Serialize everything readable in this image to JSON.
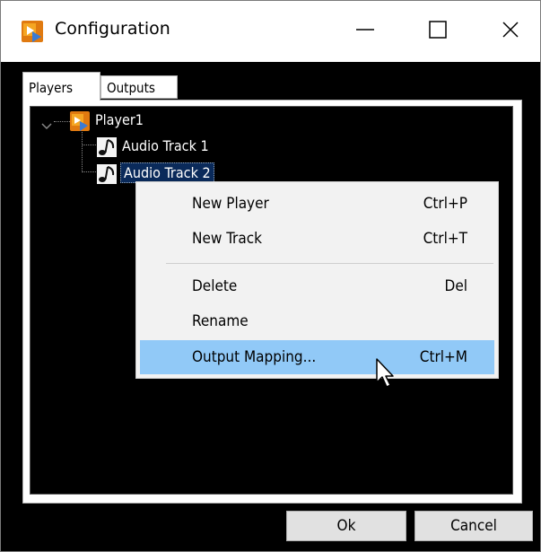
{
  "window": {
    "title": "Configuration",
    "icon": "app-player-icon",
    "controls": {
      "minimize_icon": "minimize-icon",
      "maximize_icon": "maximize-icon",
      "close_icon": "close-icon"
    }
  },
  "tabs": [
    {
      "label": "Players",
      "active": true
    },
    {
      "label": "Outputs",
      "active": false
    }
  ],
  "tree": {
    "root": {
      "label": "Player1",
      "expanded": true,
      "icon": "player-icon"
    },
    "children": [
      {
        "label": "Audio Track 1",
        "icon": "music-note-icon",
        "selected": false
      },
      {
        "label": "Audio Track 2",
        "icon": "music-note-icon",
        "selected": true
      }
    ]
  },
  "context_menu": {
    "items": [
      {
        "label": "New Player",
        "shortcut": "Ctrl+P",
        "highlighted": false
      },
      {
        "label": "New Track",
        "shortcut": "Ctrl+T",
        "highlighted": false
      },
      {
        "separator": true
      },
      {
        "label": "Delete",
        "shortcut": "Del",
        "highlighted": false
      },
      {
        "label": "Rename",
        "shortcut": "",
        "highlighted": false
      },
      {
        "label": "Output Mapping...",
        "shortcut": "Ctrl+M",
        "highlighted": true
      }
    ]
  },
  "buttons": {
    "ok_label": "Ok",
    "cancel_label": "Cancel"
  },
  "colors": {
    "tree_background": "#000000",
    "selection": "#0a2a5a",
    "menu_highlight": "#91c9f7",
    "menu_background": "#f2f2f2"
  }
}
